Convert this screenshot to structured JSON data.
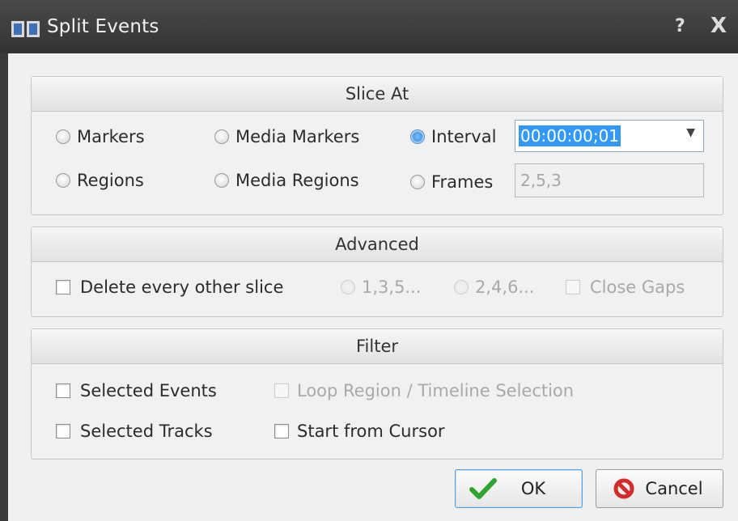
{
  "window": {
    "title": "Split Events",
    "help_symbol": "?",
    "close_symbol": "X"
  },
  "slice_at": {
    "header": "Slice At",
    "markers": "Markers",
    "media_markers": "Media Markers",
    "interval": "Interval",
    "regions": "Regions",
    "media_regions": "Media Regions",
    "frames": "Frames",
    "interval_value": "00:00:00;01",
    "frames_value": "2,5,3",
    "selected": "interval"
  },
  "advanced": {
    "header": "Advanced",
    "delete_every_other_slice": "Delete every other slice",
    "odd_option": "1,3,5...",
    "even_option": "2,4,6...",
    "close_gaps": "Close Gaps"
  },
  "filter": {
    "header": "Filter",
    "selected_events": "Selected Events",
    "loop_region": "Loop Region / Timeline Selection",
    "selected_tracks": "Selected Tracks",
    "start_from_cursor": "Start from Cursor"
  },
  "buttons": {
    "ok": "OK",
    "cancel": "Cancel"
  },
  "colors": {
    "title_bar": "#3a3a3a",
    "selection": "#3399ff",
    "ok_check": "#2fa52f",
    "cancel_icon": "#d42b2b"
  },
  "icons": {
    "app": "film-strip-icon",
    "help": "help-icon",
    "close": "close-icon",
    "ok": "checkmark-icon",
    "cancel": "no-entry-icon",
    "dropdown": "chevron-down-icon"
  }
}
